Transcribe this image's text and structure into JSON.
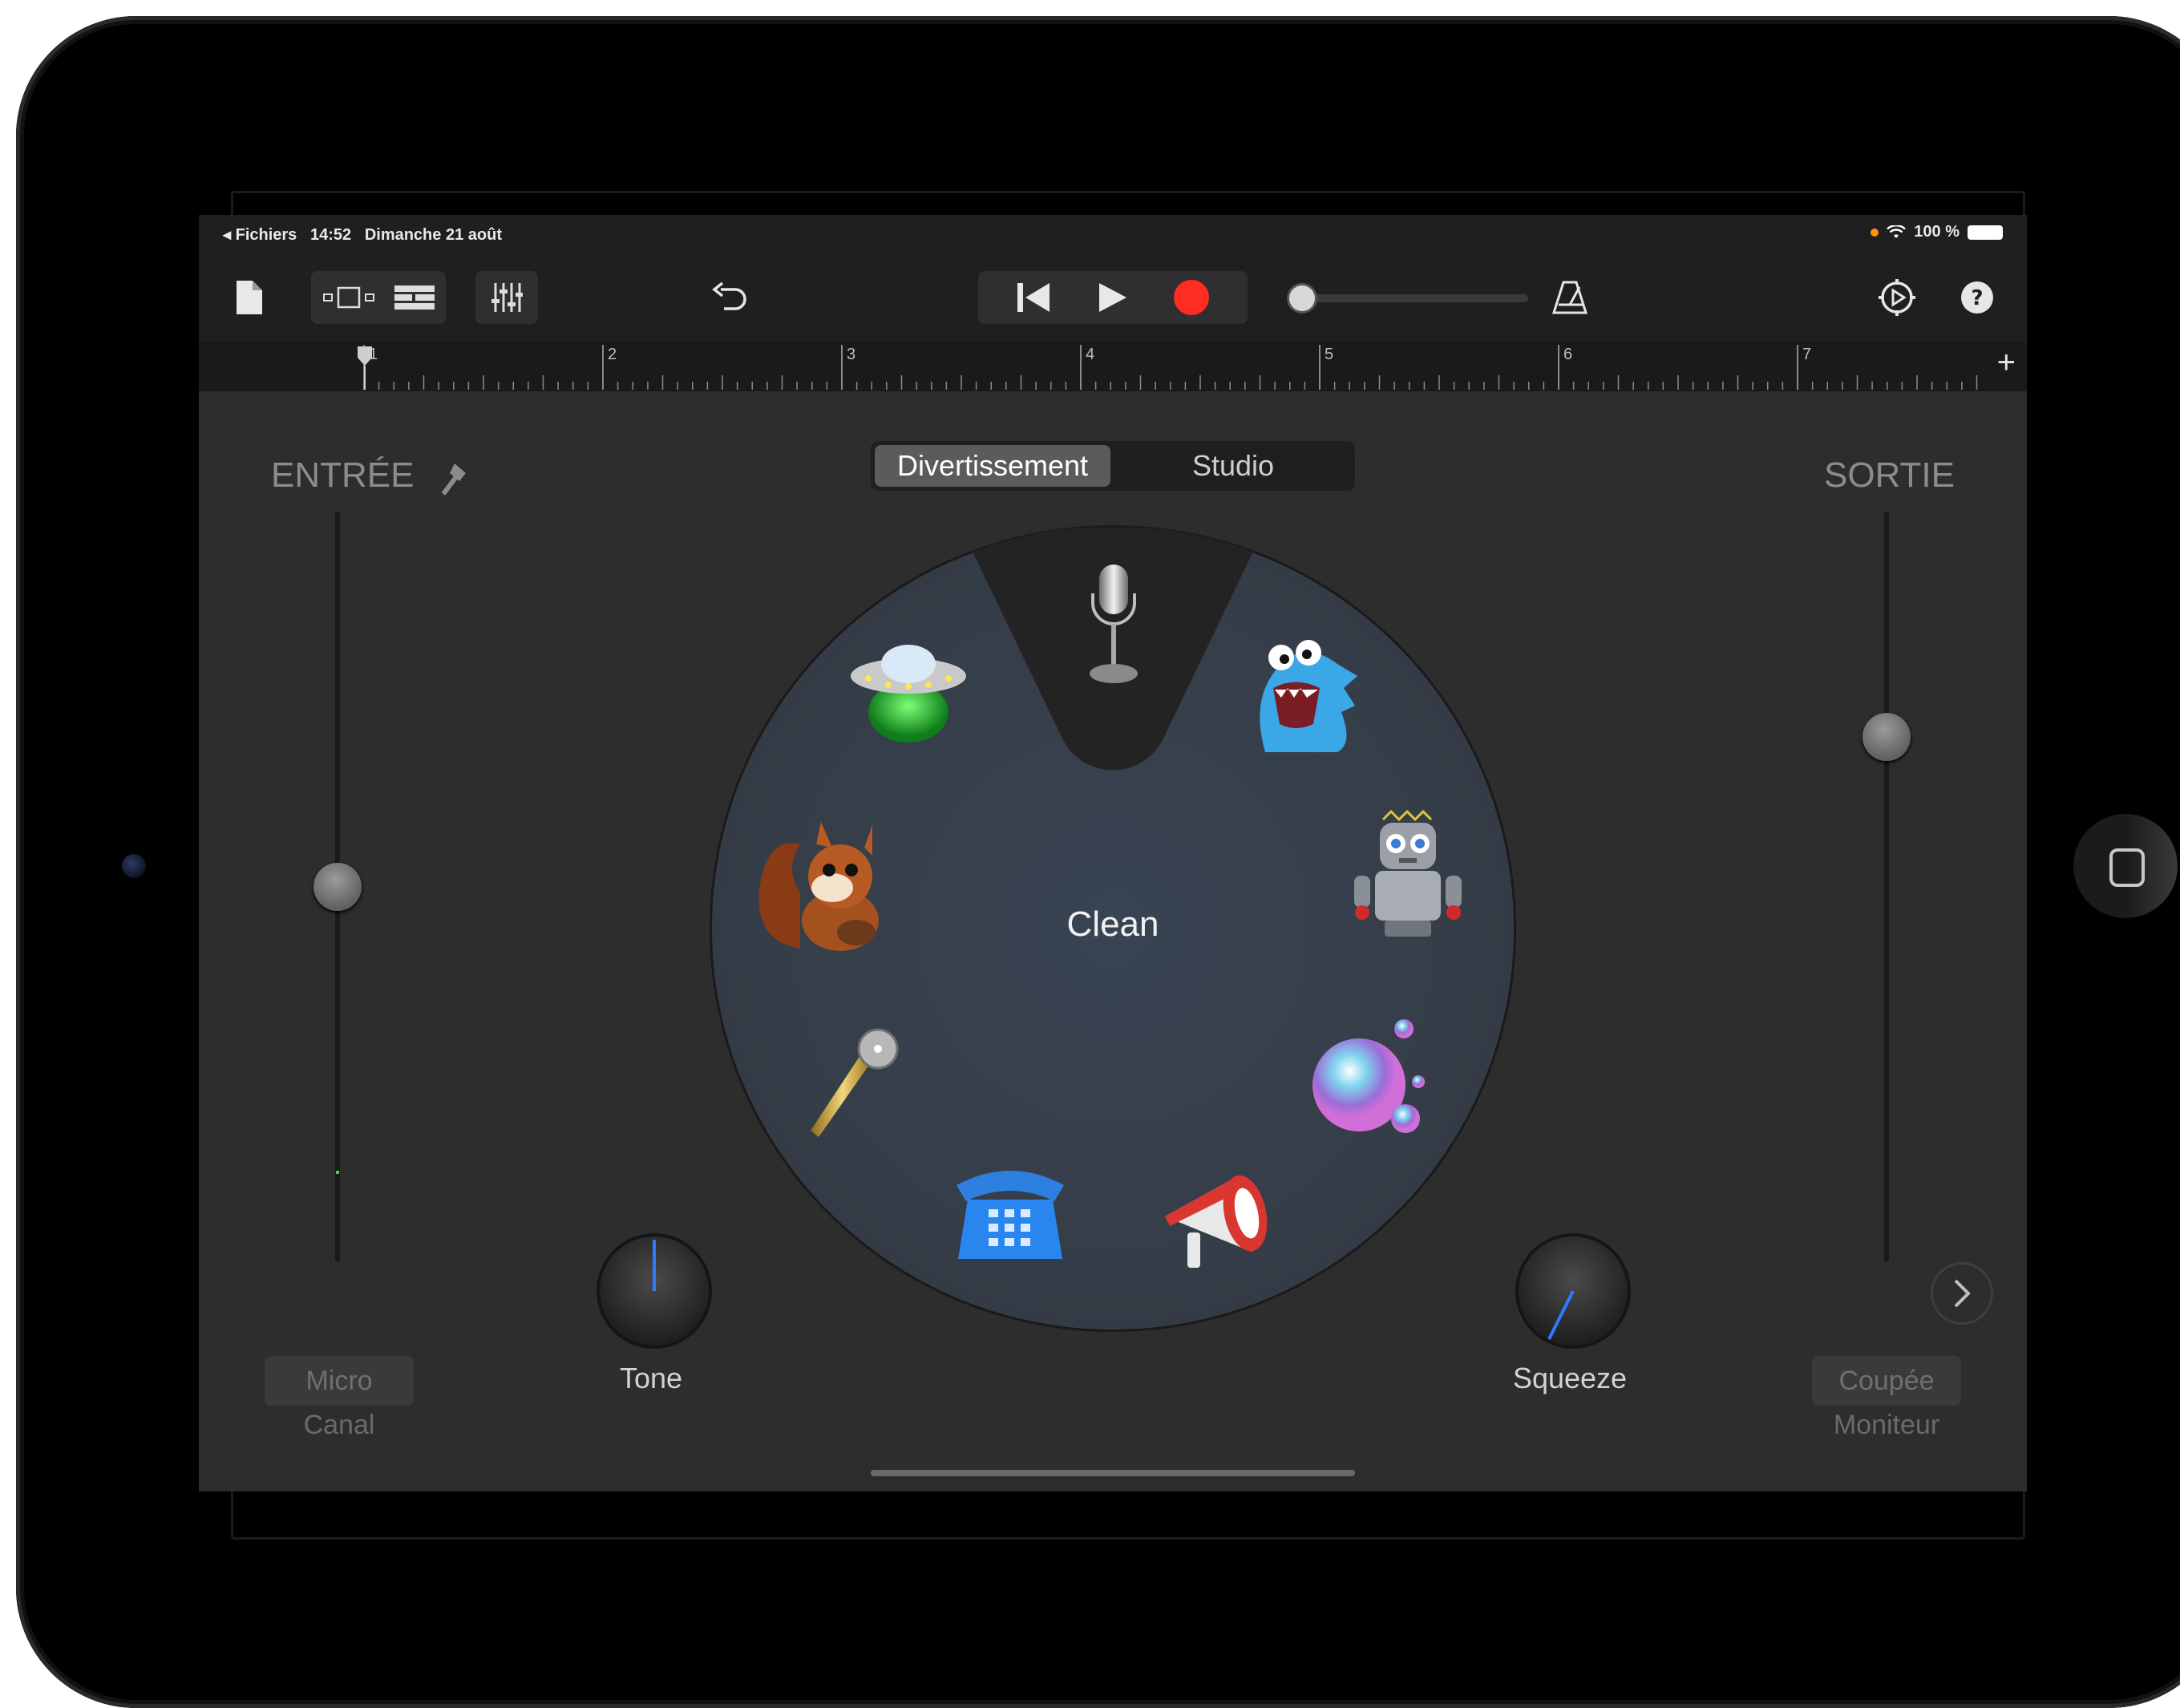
{
  "status": {
    "back_app": "Fichiers",
    "time": "14:52",
    "date": "Dimanche 21 août",
    "battery": "100 %"
  },
  "ruler": {
    "bars": [
      "1",
      "2",
      "3",
      "4",
      "5",
      "6",
      "7"
    ],
    "add_symbol": "+"
  },
  "left_panel": {
    "title": "ENTRÉE",
    "input_level": 0.5,
    "source_button": "Micro",
    "source_label": "Canal"
  },
  "right_panel": {
    "title": "SORTIE",
    "output_level": 0.7,
    "monitor_button": "Coupée",
    "monitor_label": "Moniteur"
  },
  "segmented": {
    "options": [
      "Divertissement",
      "Studio"
    ],
    "selected": "Divertissement"
  },
  "wheel": {
    "center_label": "Clean"
  },
  "knobs": {
    "left_label": "Tone",
    "right_label": "Squeeze"
  },
  "colors": {
    "record": "#ff2d21",
    "background": "#2d2d2e",
    "wheel": "#38414d"
  }
}
